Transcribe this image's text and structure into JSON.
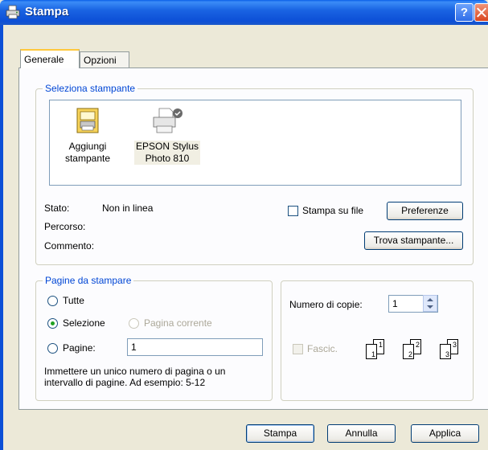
{
  "window": {
    "title": "Stampa"
  },
  "tabs": [
    {
      "label": "Generale",
      "active": true
    },
    {
      "label": "Opzioni",
      "active": false
    }
  ],
  "select_printer": {
    "legend": "Seleziona stampante",
    "printers": [
      {
        "name": "Aggiungi stampante",
        "line1": "Aggiungi",
        "line2": "stampante",
        "icon": "add-printer-icon"
      },
      {
        "name": "EPSON Stylus Photo 810",
        "line1": "EPSON Stylus",
        "line2": "Photo 810",
        "icon": "printer-icon",
        "selected": true
      }
    ],
    "status_label": "Stato:",
    "status_value": "Non in linea",
    "path_label": "Percorso:",
    "comment_label": "Commento:",
    "print_to_file_label": "Stampa su file",
    "preferences_button": "Preferenze",
    "find_printer_button": "Trova stampante..."
  },
  "page_range": {
    "legend": "Pagine da stampare",
    "all_label": "Tutte",
    "selection_label": "Selezione",
    "current_page_label": "Pagina corrente",
    "pages_label": "Pagine:",
    "pages_value": "1",
    "hint_line1": "Immettere un unico numero di pagina o un",
    "hint_line2": "intervallo di pagine. Ad esempio: 5-12",
    "selected": "Selezione"
  },
  "copies": {
    "count_label": "Numero di copie:",
    "count_value": "1",
    "collate_label": "Fascic.",
    "collate_pages": [
      "1",
      "1",
      "2",
      "2",
      "3",
      "3"
    ]
  },
  "buttons": {
    "print": "Stampa",
    "cancel": "Annulla",
    "apply": "Applica"
  },
  "colors": {
    "titlebar": "#0c4fd6",
    "legend_text": "#0046d5",
    "dialog_bg": "#ece9d8"
  }
}
